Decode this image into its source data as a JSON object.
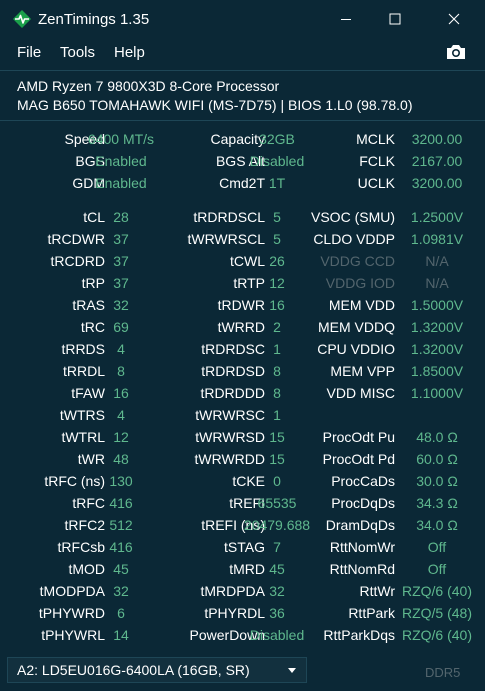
{
  "window": {
    "title": "ZenTimings 1.35",
    "app_icon": "heartbeat-icon"
  },
  "menu": {
    "file": "File",
    "tools": "Tools",
    "help": "Help",
    "screenshot_icon": "camera-icon"
  },
  "system": {
    "cpu": "AMD Ryzen 7 9800X3D 8-Core Processor",
    "board": "MAG B650 TOMAHAWK WIFI (MS-7D75) | BIOS 1.L0 (98.78.0)"
  },
  "colors": {
    "background": "#0b2836",
    "value": "#5fb88e",
    "disabled_value": "#53656d",
    "label": "#ffffff"
  },
  "rows": [
    [
      {
        "l": "Speed",
        "v": "6400 MT/s"
      },
      {
        "l": "Capacity",
        "v": "32GB"
      },
      {
        "l": "MCLK",
        "v": "3200.00"
      }
    ],
    [
      {
        "l": "BGS",
        "v": "Enabled"
      },
      {
        "l": "BGS Alt",
        "v": "Disabled"
      },
      {
        "l": "FCLK",
        "v": "2167.00"
      }
    ],
    [
      {
        "l": "GDM",
        "v": "Enabled"
      },
      {
        "l": "Cmd2T",
        "v": "1T"
      },
      {
        "l": "UCLK",
        "v": "3200.00"
      }
    ],
    [
      {
        "l": "tCL",
        "v": "28"
      },
      {
        "l": "tRDRDSCL",
        "v": "5"
      },
      {
        "l": "VSOC (SMU)",
        "v": "1.2500V"
      }
    ],
    [
      {
        "l": "tRCDWR",
        "v": "37"
      },
      {
        "l": "tWRWRSCL",
        "v": "5"
      },
      {
        "l": "CLDO VDDP",
        "v": "1.0981V"
      }
    ],
    [
      {
        "l": "tRCDRD",
        "v": "37"
      },
      {
        "l": "tCWL",
        "v": "26"
      },
      {
        "l": "VDDG CCD",
        "v": "N/A"
      }
    ],
    [
      {
        "l": "tRP",
        "v": "37"
      },
      {
        "l": "tRTP",
        "v": "12"
      },
      {
        "l": "VDDG IOD",
        "v": "N/A"
      }
    ],
    [
      {
        "l": "tRAS",
        "v": "32"
      },
      {
        "l": "tRDWR",
        "v": "16"
      },
      {
        "l": "MEM VDD",
        "v": "1.5000V"
      }
    ],
    [
      {
        "l": "tRC",
        "v": "69"
      },
      {
        "l": "tWRRD",
        "v": "2"
      },
      {
        "l": "MEM VDDQ",
        "v": "1.3200V"
      }
    ],
    [
      {
        "l": "tRRDS",
        "v": "4"
      },
      {
        "l": "tRDRDSC",
        "v": "1"
      },
      {
        "l": "CPU VDDIO",
        "v": "1.3200V"
      }
    ],
    [
      {
        "l": "tRRDL",
        "v": "8"
      },
      {
        "l": "tRDRDSD",
        "v": "8"
      },
      {
        "l": "MEM VPP",
        "v": "1.8500V"
      }
    ],
    [
      {
        "l": "tFAW",
        "v": "16"
      },
      {
        "l": "tRDRDDD",
        "v": "8"
      },
      {
        "l": "VDD MISC",
        "v": "1.1000V"
      }
    ],
    [
      {
        "l": "tWTRS",
        "v": "4"
      },
      {
        "l": "tWRWRSC",
        "v": "1"
      },
      {
        "l": "",
        "v": ""
      }
    ],
    [
      {
        "l": "tWTRL",
        "v": "12"
      },
      {
        "l": "tWRWRSD",
        "v": "15"
      },
      {
        "l": "ProcOdt Pu",
        "v": "48.0 Ω"
      }
    ],
    [
      {
        "l": "tWR",
        "v": "48"
      },
      {
        "l": "tWRWRDD",
        "v": "15"
      },
      {
        "l": "ProcOdt Pd",
        "v": "60.0 Ω"
      }
    ],
    [
      {
        "l": "tRFC (ns)",
        "v": "130"
      },
      {
        "l": "tCKE",
        "v": "0"
      },
      {
        "l": "ProcCaDs",
        "v": "30.0 Ω"
      }
    ],
    [
      {
        "l": "tRFC",
        "v": "416"
      },
      {
        "l": "tREFI",
        "v": "65535"
      },
      {
        "l": "ProcDqDs",
        "v": "34.3 Ω"
      }
    ],
    [
      {
        "l": "tRFC2",
        "v": "512"
      },
      {
        "l": "tREFI (ns)",
        "v": "20479.688"
      },
      {
        "l": "DramDqDs",
        "v": "34.0 Ω"
      }
    ],
    [
      {
        "l": "tRFCsb",
        "v": "416"
      },
      {
        "l": "tSTAG",
        "v": "7"
      },
      {
        "l": "RttNomWr",
        "v": "Off"
      }
    ],
    [
      {
        "l": "tMOD",
        "v": "45"
      },
      {
        "l": "tMRD",
        "v": "45"
      },
      {
        "l": "RttNomRd",
        "v": "Off"
      }
    ],
    [
      {
        "l": "tMODPDA",
        "v": "32"
      },
      {
        "l": "tMRDPDA",
        "v": "32"
      },
      {
        "l": "RttWr",
        "v": "RZQ/6 (40)"
      }
    ],
    [
      {
        "l": "tPHYWRD",
        "v": "6"
      },
      {
        "l": "tPHYRDL",
        "v": "36"
      },
      {
        "l": "RttPark",
        "v": "RZQ/5 (48)"
      }
    ],
    [
      {
        "l": "tPHYWRL",
        "v": "14"
      },
      {
        "l": "PowerDown",
        "v": "Disabled"
      },
      {
        "l": "RttParkDqs",
        "v": "RZQ/6 (40)"
      }
    ]
  ],
  "footer": {
    "dimm_selected": "A2: LD5EU016G-6400LA (16GB, SR)",
    "memory_type": "DDR5"
  }
}
